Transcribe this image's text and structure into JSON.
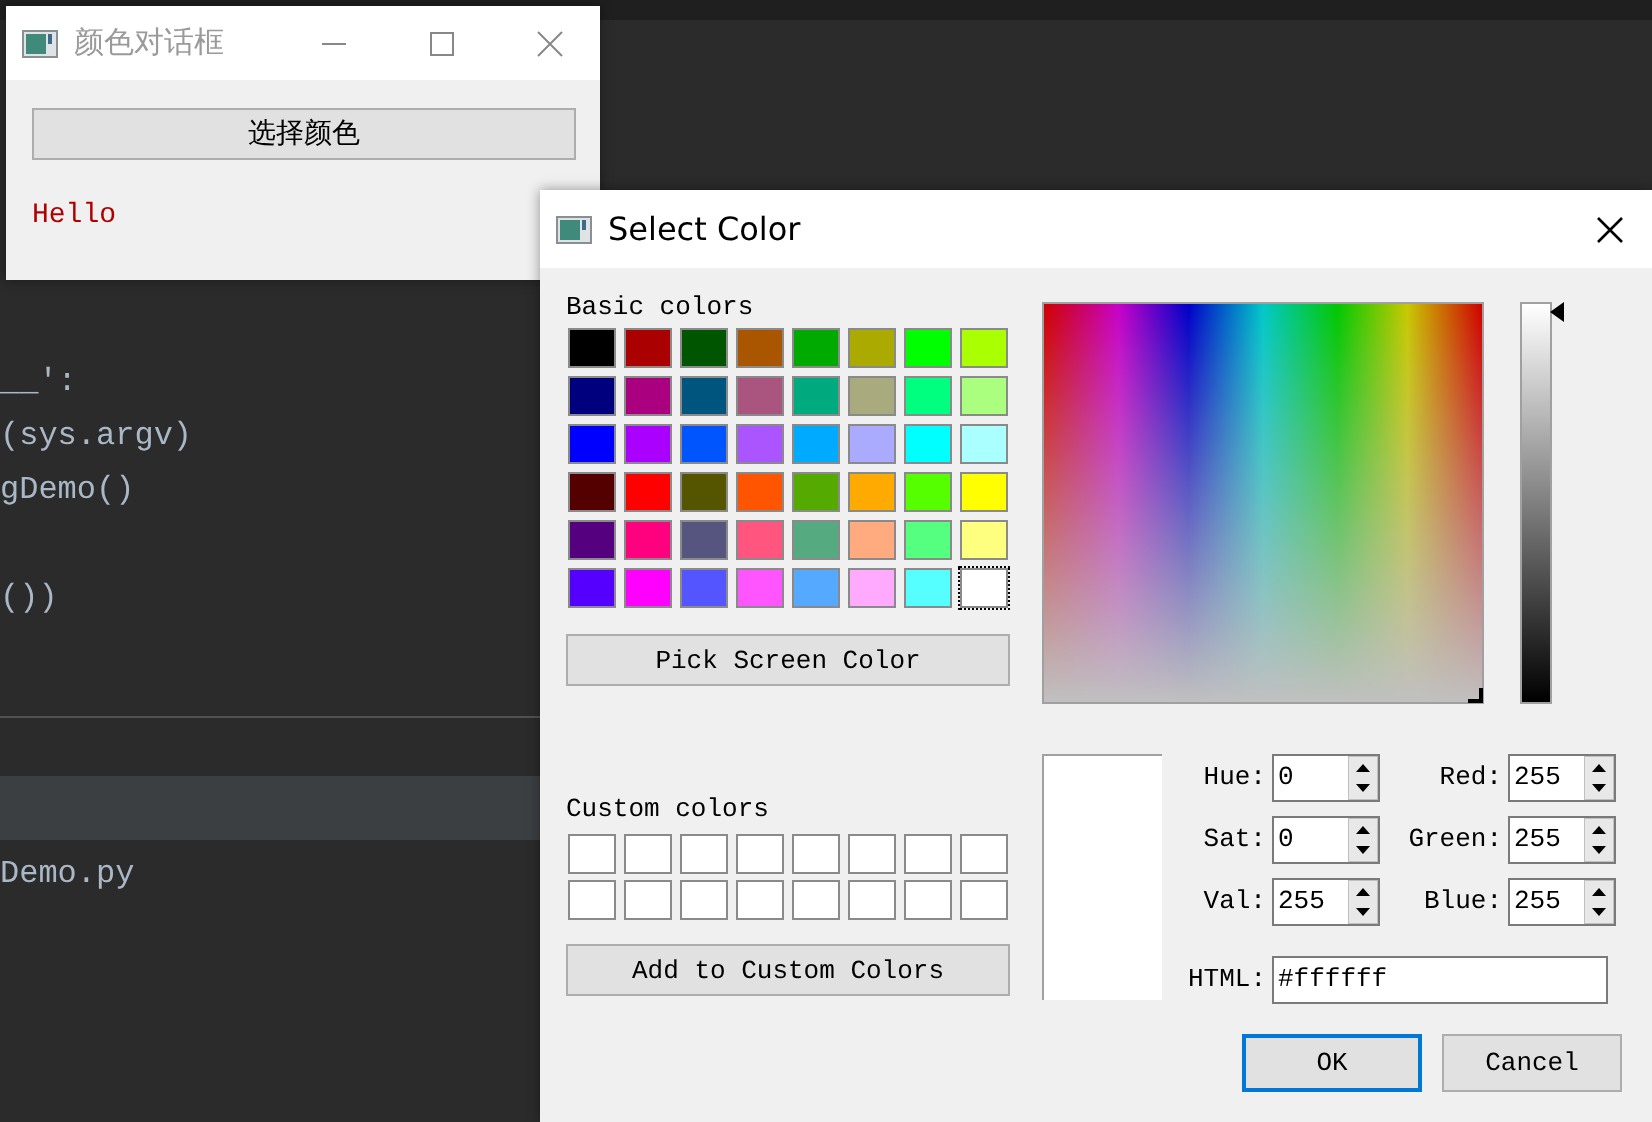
{
  "editor": {
    "code_lines": [
      {
        "text": "__':"
      },
      {
        "text": "(sys.argv)"
      },
      {
        "text": "gDemo()"
      },
      {
        "text": "())"
      }
    ],
    "file_name": "Demo.py"
  },
  "main_window": {
    "title": "颜色对话框",
    "button": "选择颜色",
    "label": "Hello"
  },
  "dialog": {
    "title": "Select Color",
    "basic_label": "Basic colors",
    "basic_colors": [
      {
        "color": "#000000",
        "selected": false
      },
      {
        "color": "#aa0000",
        "selected": false
      },
      {
        "color": "#005500",
        "selected": false
      },
      {
        "color": "#aa5500",
        "selected": false
      },
      {
        "color": "#00aa00",
        "selected": false
      },
      {
        "color": "#aaaa00",
        "selected": false
      },
      {
        "color": "#00ff00",
        "selected": false
      },
      {
        "color": "#aaff00",
        "selected": false
      },
      {
        "color": "#00007f",
        "selected": false
      },
      {
        "color": "#aa007f",
        "selected": false
      },
      {
        "color": "#00557f",
        "selected": false
      },
      {
        "color": "#aa557f",
        "selected": false
      },
      {
        "color": "#00aa7f",
        "selected": false
      },
      {
        "color": "#aaaa7f",
        "selected": false
      },
      {
        "color": "#00ff7f",
        "selected": false
      },
      {
        "color": "#aaff7f",
        "selected": false
      },
      {
        "color": "#0000ff",
        "selected": false
      },
      {
        "color": "#aa00ff",
        "selected": false
      },
      {
        "color": "#0055ff",
        "selected": false
      },
      {
        "color": "#aa55ff",
        "selected": false
      },
      {
        "color": "#00aaff",
        "selected": false
      },
      {
        "color": "#aaaaff",
        "selected": false
      },
      {
        "color": "#00ffff",
        "selected": false
      },
      {
        "color": "#aaffff",
        "selected": false
      },
      {
        "color": "#550000",
        "selected": false
      },
      {
        "color": "#ff0000",
        "selected": false
      },
      {
        "color": "#555500",
        "selected": false
      },
      {
        "color": "#ff5500",
        "selected": false
      },
      {
        "color": "#55aa00",
        "selected": false
      },
      {
        "color": "#ffaa00",
        "selected": false
      },
      {
        "color": "#55ff00",
        "selected": false
      },
      {
        "color": "#ffff00",
        "selected": false
      },
      {
        "color": "#55007f",
        "selected": false
      },
      {
        "color": "#ff007f",
        "selected": false
      },
      {
        "color": "#55557f",
        "selected": false
      },
      {
        "color": "#ff557f",
        "selected": false
      },
      {
        "color": "#55aa7f",
        "selected": false
      },
      {
        "color": "#ffaa7f",
        "selected": false
      },
      {
        "color": "#55ff7f",
        "selected": false
      },
      {
        "color": "#ffff7f",
        "selected": false
      },
      {
        "color": "#5500ff",
        "selected": false
      },
      {
        "color": "#ff00ff",
        "selected": false
      },
      {
        "color": "#5555ff",
        "selected": false
      },
      {
        "color": "#ff55ff",
        "selected": false
      },
      {
        "color": "#55aaff",
        "selected": false
      },
      {
        "color": "#ffaaff",
        "selected": false
      },
      {
        "color": "#55ffff",
        "selected": false
      },
      {
        "color": "#FFFFFF",
        "selected": true
      }
    ],
    "pick_button": "Pick Screen Color",
    "custom_label": "Custom colors",
    "custom_colors": [
      {
        "color": "#FFFFFF"
      },
      {
        "color": "#FFFFFF"
      },
      {
        "color": "#FFFFFF"
      },
      {
        "color": "#FFFFFF"
      },
      {
        "color": "#FFFFFF"
      },
      {
        "color": "#FFFFFF"
      },
      {
        "color": "#FFFFFF"
      },
      {
        "color": "#FFFFFF"
      },
      {
        "color": "#FFFFFF"
      },
      {
        "color": "#FFFFFF"
      },
      {
        "color": "#FFFFFF"
      },
      {
        "color": "#FFFFFF"
      },
      {
        "color": "#FFFFFF"
      },
      {
        "color": "#FFFFFF"
      },
      {
        "color": "#FFFFFF"
      },
      {
        "color": "#FFFFFF"
      }
    ],
    "add_button": "Add to Custom Colors",
    "level": 1,
    "fields": [
      {
        "label": "Hue:",
        "value": "0"
      },
      {
        "label": "Red:",
        "value": "255"
      },
      {
        "label": "Sat:",
        "value": "0"
      },
      {
        "label": "Green:",
        "value": "255"
      },
      {
        "label": "Val:",
        "value": "255"
      },
      {
        "label": "Blue:",
        "value": "255"
      }
    ],
    "html": {
      "label": "HTML:",
      "text": "#ffffff"
    },
    "buttons": [
      {
        "label": "OK",
        "default": true
      },
      {
        "label": "Cancel",
        "default": false
      }
    ]
  }
}
